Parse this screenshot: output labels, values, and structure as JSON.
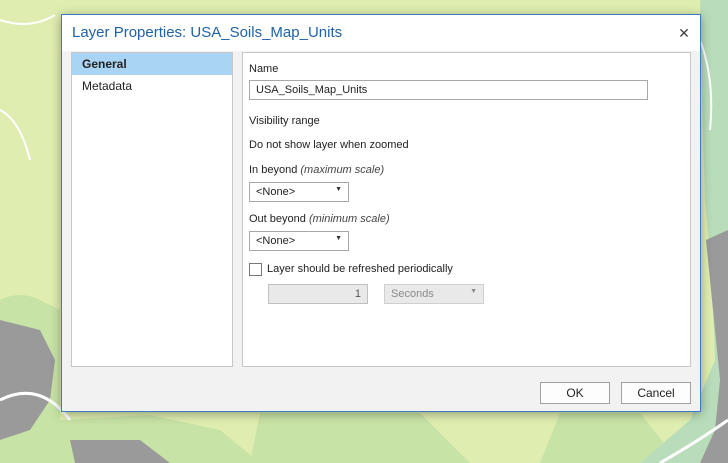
{
  "dialog": {
    "title": "Layer Properties: USA_Soils_Map_Units",
    "close_glyph": "✕"
  },
  "nav": {
    "items": [
      {
        "label": "General",
        "selected": true
      },
      {
        "label": "Metadata",
        "selected": false
      }
    ]
  },
  "general": {
    "name_label": "Name",
    "name_value": "USA_Soils_Map_Units",
    "visibility_heading": "Visibility range",
    "visibility_text": "Do not show layer when zoomed",
    "in_beyond_label": "In beyond",
    "in_beyond_hint": "(maximum scale)",
    "in_beyond_value": "<None>",
    "out_beyond_label": "Out beyond",
    "out_beyond_hint": "(minimum scale)",
    "out_beyond_value": "<None>",
    "refresh_label": "Layer should be refreshed periodically",
    "refresh_checked": false,
    "refresh_interval": "1",
    "refresh_unit": "Seconds"
  },
  "buttons": {
    "ok": "OK",
    "cancel": "Cancel"
  },
  "colors": {
    "accent": "#1e62a7",
    "selection": "#a9d4f3",
    "map_green": "#dfeeb0",
    "map_road": "#9a9a9a"
  }
}
